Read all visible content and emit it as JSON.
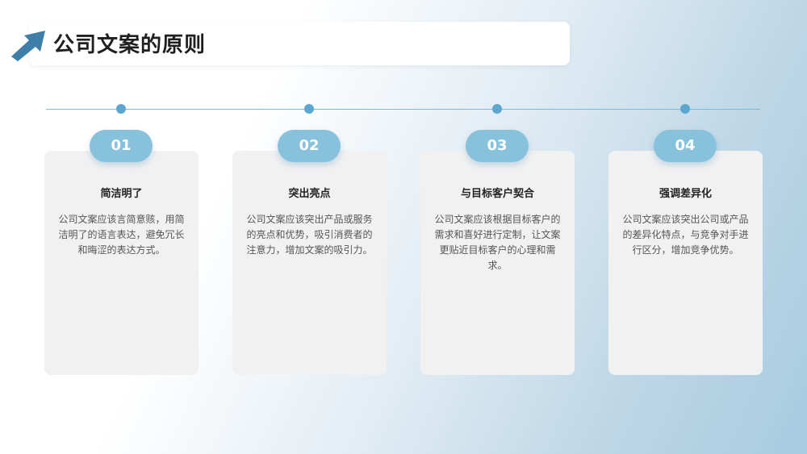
{
  "header": {
    "title": "公司文案的原则"
  },
  "colors": {
    "accent": "#5ba7cf",
    "badge": "#88c1dc",
    "arrow": "#3d7fa8",
    "card": "#f1f1f2"
  },
  "principles": [
    {
      "number": "01",
      "title": "简洁明了",
      "text": "公司文案应该言简意赅，用简洁明了的语言表达，避免冗长和晦涩的表达方式。"
    },
    {
      "number": "02",
      "title": "突出亮点",
      "text": "公司文案应该突出产品或服务的亮点和优势，吸引消费者的注意力，增加文案的吸引力。"
    },
    {
      "number": "03",
      "title": "与目标客户契合",
      "text": "公司文案应该根据目标客户的需求和喜好进行定制，让文案更贴近目标客户的心理和需求。"
    },
    {
      "number": "04",
      "title": "强调差异化",
      "text": "公司文案应该突出公司或产品的差异化特点，与竞争对手进行区分，增加竞争优势。"
    }
  ]
}
